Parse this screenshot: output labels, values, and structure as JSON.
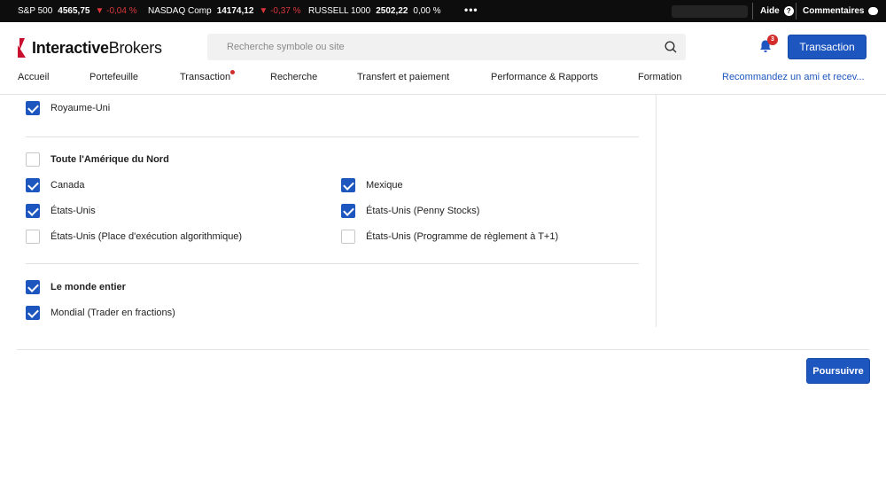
{
  "ticker": [
    {
      "name": "S&P 500",
      "value": "4565,75",
      "change": "▼ -0,04 %",
      "dir": "neg"
    },
    {
      "name": "NASDAQ Comp",
      "value": "14174,12",
      "change": "▼ -0,37 %",
      "dir": "neg"
    },
    {
      "name": "RUSSELL 1000",
      "value": "2502,22",
      "change": "0,00 %",
      "dir": "zero"
    }
  ],
  "ticker_more": "•••",
  "help_label": "Aide",
  "help_icon": "?",
  "feedback_label": "Commentaires",
  "logo": {
    "part1": "Interactive",
    "part2": "Brokers",
    "brand_color": "#c8102e"
  },
  "search": {
    "placeholder": "Recherche symbole ou site",
    "icon": "search-icon"
  },
  "notifications": {
    "count": "3",
    "icon": "bell-icon"
  },
  "trade_button": "Transaction",
  "nav": [
    "Accueil",
    "Portefeuille",
    "Transaction",
    "Recherche",
    "Transfert et paiement",
    "Performance & Rapports",
    "Formation",
    "Recommandez un ami et recev..."
  ],
  "sections": {
    "europe": {
      "items": [
        {
          "label": "Royaume-Uni",
          "checked": true
        }
      ]
    },
    "north_america": {
      "title": "Toute l'Amérique du Nord",
      "title_checked": false,
      "items": [
        {
          "label": "Canada",
          "checked": true
        },
        {
          "label": "Mexique",
          "checked": true
        },
        {
          "label": "États-Unis",
          "checked": true
        },
        {
          "label": "États-Unis (Penny Stocks)",
          "checked": true
        },
        {
          "label": "États-Unis (Place d'exécution algorithmique)",
          "checked": false
        },
        {
          "label": "États-Unis (Programme de règlement à T+1)",
          "checked": false
        }
      ]
    },
    "world": {
      "title": "Le monde entier",
      "title_checked": true,
      "items": [
        {
          "label": "Mondial (Trader en fractions)",
          "checked": true
        }
      ]
    }
  },
  "continue_button": "Poursuivre",
  "colors": {
    "accent": "#1e56bf",
    "negative": "#d9373b",
    "ticker_bg": "#0d0d0d"
  }
}
